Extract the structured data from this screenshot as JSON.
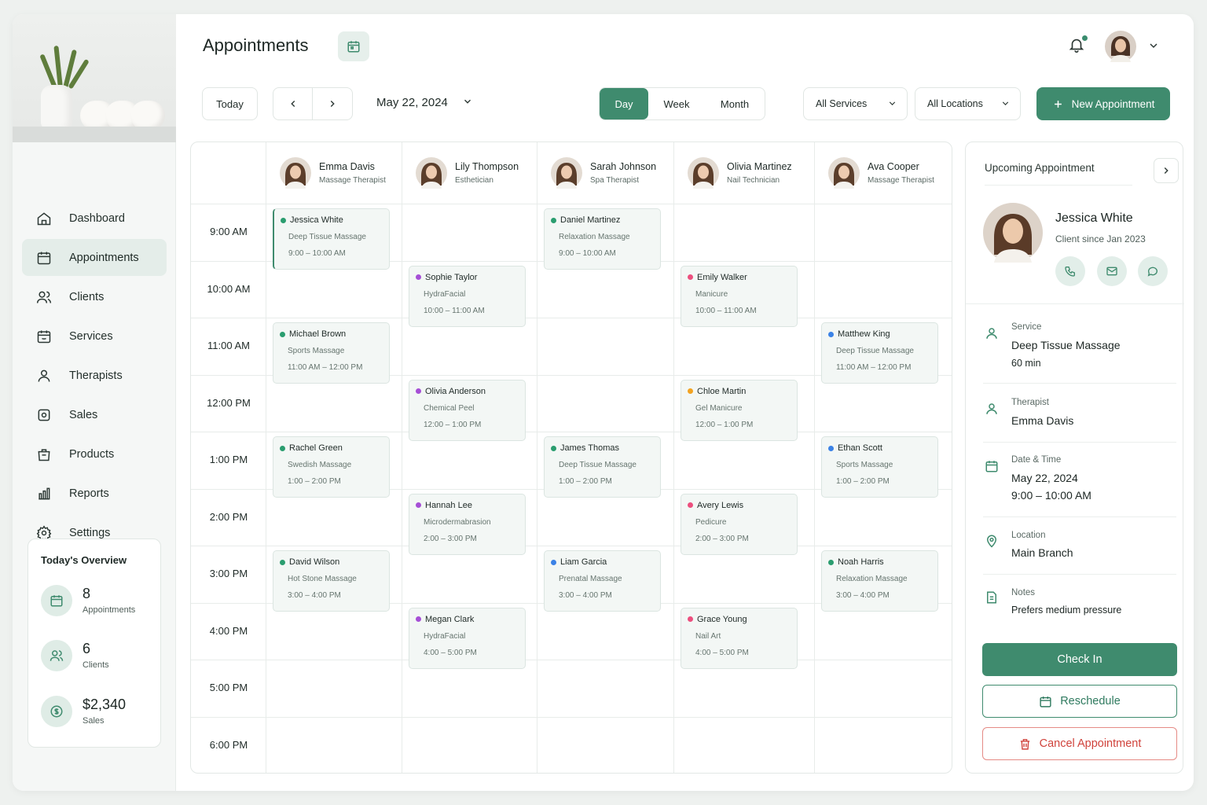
{
  "nav": {
    "items": [
      {
        "label": "Dashboard",
        "icon": "home-icon"
      },
      {
        "label": "Appointments",
        "icon": "calendar-icon",
        "active": true
      },
      {
        "label": "Clients",
        "icon": "users-icon"
      },
      {
        "label": "Services",
        "icon": "services-icon"
      },
      {
        "label": "Therapists",
        "icon": "user-icon"
      },
      {
        "label": "Sales",
        "icon": "sales-icon"
      },
      {
        "label": "Products",
        "icon": "bag-icon"
      },
      {
        "label": "Reports",
        "icon": "bar-chart-icon"
      },
      {
        "label": "Settings",
        "icon": "gear-icon"
      }
    ]
  },
  "overview": {
    "title": "Today's Overview",
    "stats": [
      {
        "value": "8",
        "label": "Appointments",
        "icon": "calendar-icon"
      },
      {
        "value": "6",
        "label": "Clients",
        "icon": "users-icon"
      },
      {
        "value": "$2,340",
        "label": "Sales",
        "icon": "dollar-icon"
      }
    ]
  },
  "header": {
    "title": "Appointments"
  },
  "toolbar": {
    "today": "Today",
    "date": "May 22, 2024",
    "views": [
      "Day",
      "Week",
      "Month"
    ],
    "active_view": "Day",
    "services": "All Services",
    "locations": "All Locations",
    "new_appointment": "New Appointment"
  },
  "colors": {
    "accent": "#3f8b6e",
    "teal": "#2a9d6f",
    "purple": "#a64fd6",
    "blue": "#3b82e6",
    "pink": "#ec4f7e",
    "orange": "#f2a322",
    "danger": "#d0433c"
  },
  "therapists": [
    {
      "name": "Emma Davis",
      "role": "Massage Therapist"
    },
    {
      "name": "Lily Thompson",
      "role": "Esthetician"
    },
    {
      "name": "Sarah Johnson",
      "role": "Spa Therapist"
    },
    {
      "name": "Olivia Martinez",
      "role": "Nail Technician"
    },
    {
      "name": "Ava Cooper",
      "role": "Massage Therapist"
    }
  ],
  "times": [
    "9:00 AM",
    "10:00 AM",
    "11:00 AM",
    "12:00 PM",
    "1:00 PM",
    "2:00 PM",
    "3:00 PM",
    "4:00 PM",
    "5:00 PM",
    "6:00 PM"
  ],
  "appointments": [
    {
      "col": 0,
      "slot": 0,
      "client": "Jessica White",
      "service": "Deep Tissue Massage",
      "time": "9:00 – 10:00 AM",
      "color": "teal"
    },
    {
      "col": 0,
      "slot": 2,
      "client": "Michael Brown",
      "service": "Sports Massage",
      "time": "11:00 AM – 12:00 PM",
      "color": "teal"
    },
    {
      "col": 0,
      "slot": 4,
      "client": "Rachel Green",
      "service": "Swedish Massage",
      "time": "1:00 – 2:00 PM",
      "color": "teal"
    },
    {
      "col": 0,
      "slot": 6,
      "client": "David Wilson",
      "service": "Hot Stone Massage",
      "time": "3:00 – 4:00 PM",
      "color": "teal"
    },
    {
      "col": 1,
      "slot": 1,
      "client": "Sophie Taylor",
      "service": "HydraFacial",
      "time": "10:00 – 11:00 AM",
      "color": "purple"
    },
    {
      "col": 1,
      "slot": 3,
      "client": "Olivia Anderson",
      "service": "Chemical Peel",
      "time": "12:00 – 1:00 PM",
      "color": "purple"
    },
    {
      "col": 1,
      "slot": 5,
      "client": "Hannah Lee",
      "service": "Microdermabrasion",
      "time": "2:00 – 3:00 PM",
      "color": "purple"
    },
    {
      "col": 1,
      "slot": 7,
      "client": "Megan Clark",
      "service": "HydraFacial",
      "time": "4:00 – 5:00 PM",
      "color": "purple"
    },
    {
      "col": 2,
      "slot": 0,
      "client": "Daniel Martinez",
      "service": "Relaxation Massage",
      "time": "9:00 – 10:00 AM",
      "color": "teal"
    },
    {
      "col": 2,
      "slot": 4,
      "client": "James Thomas",
      "service": "Deep Tissue Massage",
      "time": "1:00 – 2:00 PM",
      "color": "teal"
    },
    {
      "col": 2,
      "slot": 6,
      "client": "Liam Garcia",
      "service": "Prenatal Massage",
      "time": "3:00 – 4:00 PM",
      "color": "blue"
    },
    {
      "col": 3,
      "slot": 1,
      "client": "Emily Walker",
      "service": "Manicure",
      "time": "10:00 – 11:00 AM",
      "color": "pink"
    },
    {
      "col": 3,
      "slot": 3,
      "client": "Chloe Martin",
      "service": "Gel Manicure",
      "time": "12:00 – 1:00 PM",
      "color": "orange"
    },
    {
      "col": 3,
      "slot": 5,
      "client": "Avery Lewis",
      "service": "Pedicure",
      "time": "2:00 – 3:00 PM",
      "color": "pink"
    },
    {
      "col": 3,
      "slot": 7,
      "client": "Grace Young",
      "service": "Nail Art",
      "time": "4:00 – 5:00 PM",
      "color": "pink"
    },
    {
      "col": 4,
      "slot": 2,
      "client": "Matthew King",
      "service": "Deep Tissue Massage",
      "time": "11:00 AM – 12:00 PM",
      "color": "blue"
    },
    {
      "col": 4,
      "slot": 4,
      "client": "Ethan Scott",
      "service": "Sports Massage",
      "time": "1:00 – 2:00 PM",
      "color": "blue"
    },
    {
      "col": 4,
      "slot": 6,
      "client": "Noah Harris",
      "service": "Relaxation Massage",
      "time": "3:00 – 4:00 PM",
      "color": "teal"
    }
  ],
  "panel": {
    "title": "Upcoming Appointment",
    "client_name": "Jessica White",
    "client_since": "Client since Jan 2023",
    "service_label": "Service",
    "service": "Deep Tissue Massage",
    "duration": "60 min",
    "therapist_label": "Therapist",
    "therapist": "Emma Davis",
    "datetime_label": "Date & Time",
    "date": "May 22, 2024",
    "time": "9:00 – 10:00 AM",
    "location_label": "Location",
    "location": "Main Branch",
    "notes_label": "Notes",
    "notes": "Prefers medium pressure",
    "check_in": "Check In",
    "reschedule": "Reschedule",
    "cancel": "Cancel Appointment"
  }
}
